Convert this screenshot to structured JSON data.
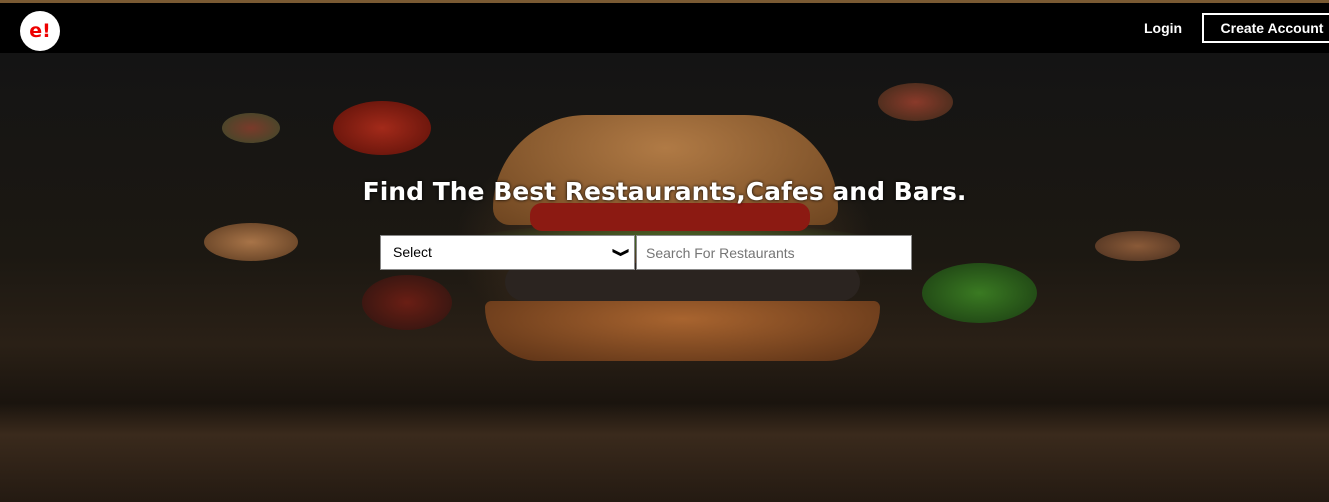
{
  "nav": {
    "logo": "e!",
    "login": "Login",
    "create_account": "Create Account"
  },
  "hero": {
    "title": "Find The Best Restaurants,Cafes and Bars.",
    "select": {
      "selected": "Select"
    },
    "search": {
      "placeholder": "Search For Restaurants",
      "value": ""
    }
  }
}
